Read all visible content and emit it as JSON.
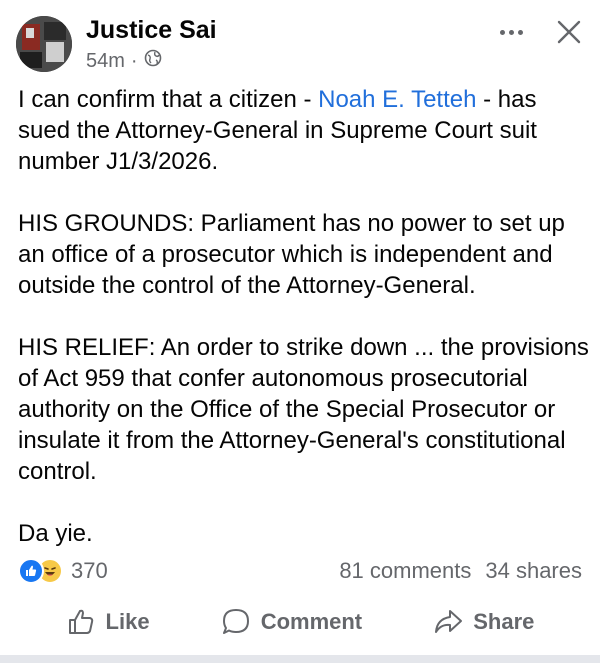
{
  "post": {
    "author": "Justice Sai",
    "time": "54m",
    "separator": "·",
    "audience_icon": "globe-icon",
    "body": {
      "line1_pre": "I can confirm that a citizen - ",
      "mention": "Noah E. Tetteh",
      "line1_post": "  - has sued the Attorney-General in Supreme Court suit number J1/3/2026.",
      "grounds": "HIS GROUNDS: Parliament has no power to set up an office of a prosecutor which is independent and outside the control of the Attorney-General.",
      "relief": "HIS RELIEF: An order to strike down ... the provisions of Act 959 that confer autonomous prosecutorial authority on the Office of the Special Prosecutor or insulate it from the Attorney-General's constitutional control.",
      "closing": "Da yie."
    }
  },
  "engagement": {
    "reaction_count": "370",
    "comments": "81 comments",
    "shares": "34 shares"
  },
  "actions": {
    "like": "Like",
    "comment": "Comment",
    "share": "Share"
  },
  "colors": {
    "mention": "#216fdb",
    "like_blue": "#1877f2",
    "haha_yellow": "#f7c948",
    "secondary_text": "#65676b"
  }
}
